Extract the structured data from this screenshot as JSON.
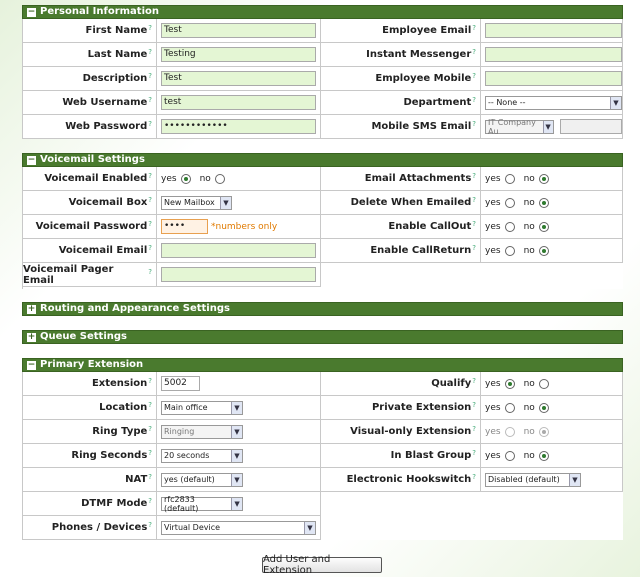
{
  "personal": {
    "title": "Personal Information",
    "left": [
      {
        "label": "First Name",
        "value": "Test"
      },
      {
        "label": "Last Name",
        "value": "Testing"
      },
      {
        "label": "Description",
        "value": "Test"
      },
      {
        "label": "Web Username",
        "value": "test"
      },
      {
        "label": "Web Password",
        "value": "••••••••••••"
      }
    ],
    "right": [
      {
        "label": "Employee Email",
        "value": ""
      },
      {
        "label": "Instant Messenger",
        "value": ""
      },
      {
        "label": "Employee Mobile",
        "value": ""
      },
      {
        "label": "Department",
        "value": "-- None --"
      },
      {
        "label": "Mobile SMS Email",
        "value": "IT Company Au",
        "extra": ""
      }
    ]
  },
  "voicemail": {
    "title": "Voicemail Settings",
    "enabled": {
      "label": "Voicemail Enabled",
      "yes": "yes",
      "no": "no",
      "selected": "yes"
    },
    "box": {
      "label": "Voicemail Box",
      "value": "New Mailbox"
    },
    "password": {
      "label": "Voicemail Password",
      "value": "••••",
      "hint": "*numbers only"
    },
    "email": {
      "label": "Voicemail Email",
      "value": ""
    },
    "pager": {
      "label": "Voicemail Pager Email",
      "value": ""
    },
    "attachments": {
      "label": "Email Attachments",
      "yes": "yes",
      "no": "no",
      "selected": "no"
    },
    "delete": {
      "label": "Delete When Emailed",
      "yes": "yes",
      "no": "no",
      "selected": "no"
    },
    "callout": {
      "label": "Enable CallOut",
      "yes": "yes",
      "no": "no",
      "selected": "no"
    },
    "callreturn": {
      "label": "Enable CallReturn",
      "yes": "yes",
      "no": "no",
      "selected": "no"
    }
  },
  "routing": {
    "title": "Routing and Appearance Settings"
  },
  "queue": {
    "title": "Queue Settings"
  },
  "extension": {
    "title": "Primary Extension",
    "ext": {
      "label": "Extension",
      "value": "5002"
    },
    "location": {
      "label": "Location",
      "value": "Main office"
    },
    "ringtype": {
      "label": "Ring Type",
      "value": "Ringing"
    },
    "ringsec": {
      "label": "Ring Seconds",
      "value": "20 seconds"
    },
    "nat": {
      "label": "NAT",
      "value": "yes (default)"
    },
    "dtmf": {
      "label": "DTMF Mode",
      "value": "rfc2833 (default)"
    },
    "phones": {
      "label": "Phones / Devices",
      "value": "Virtual Device"
    },
    "qualify": {
      "label": "Qualify",
      "yes": "yes",
      "no": "no",
      "selected": "yes"
    },
    "private": {
      "label": "Private Extension",
      "yes": "yes",
      "no": "no",
      "selected": "no"
    },
    "visual": {
      "label": "Visual-only Extension",
      "yes": "yes",
      "no": "no",
      "selected": "no"
    },
    "blast": {
      "label": "In Blast Group",
      "yes": "yes",
      "no": "no",
      "selected": "no"
    },
    "hook": {
      "label": "Electronic Hookswitch",
      "value": "Disabled (default)"
    }
  },
  "submit": "Add User and Extension",
  "help_mark": "?"
}
